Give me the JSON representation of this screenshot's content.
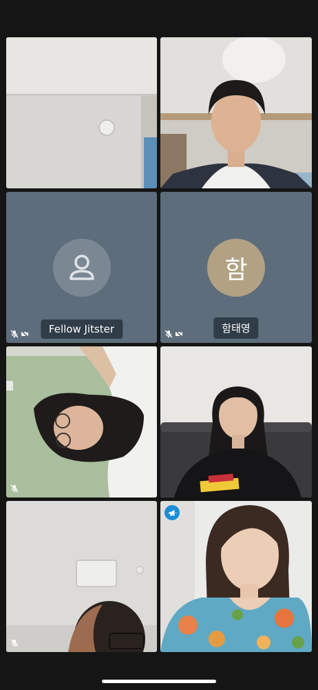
{
  "participants": [
    {
      "id": "p1",
      "type": "video",
      "scene": "ceiling-wall"
    },
    {
      "id": "p2",
      "type": "video",
      "scene": "boy-ceiling"
    },
    {
      "id": "p3",
      "type": "avatar-default",
      "display_name": "Fellow Jitster",
      "audio_muted": true,
      "video_muted": true
    },
    {
      "id": "p4",
      "type": "avatar-initial",
      "display_name": "함태영",
      "initial": "함",
      "audio_muted": true,
      "video_muted": true
    },
    {
      "id": "p5",
      "type": "video",
      "scene": "girl-rotated",
      "audio_muted": true
    },
    {
      "id": "p6",
      "type": "video",
      "scene": "girl-sofa"
    },
    {
      "id": "p7",
      "type": "video",
      "scene": "ceiling-head",
      "audio_muted": true
    },
    {
      "id": "p8",
      "type": "video",
      "scene": "woman-floral",
      "moderator": true
    }
  ],
  "colors": {
    "background": "#151515",
    "placeholder_tile": "#5d6d7c",
    "default_avatar": "#7b8894",
    "initial_avatar": "#b2a283",
    "moderator_badge": "#1a8ed7"
  }
}
